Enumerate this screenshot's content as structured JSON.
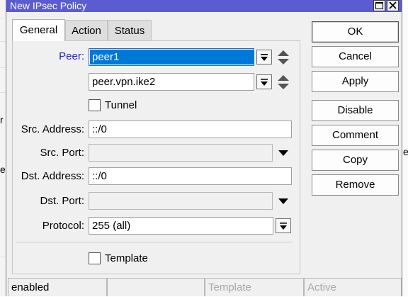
{
  "window": {
    "title": "New IPsec Policy"
  },
  "background_fragments": {
    "left_1": "r",
    "left_2": "er",
    "right_1": "e"
  },
  "tabs": [
    {
      "label": "General",
      "active": true
    },
    {
      "label": "Action",
      "active": false
    },
    {
      "label": "Status",
      "active": false
    }
  ],
  "form": {
    "peer": {
      "label": "Peer:",
      "value": "peer1",
      "value2": "peer.vpn.ike2"
    },
    "tunnel": {
      "label": "Tunnel",
      "checked": false
    },
    "src_address": {
      "label": "Src. Address:",
      "value": "::/0"
    },
    "src_port": {
      "label": "Src. Port:",
      "value": ""
    },
    "dst_address": {
      "label": "Dst. Address:",
      "value": "::/0"
    },
    "dst_port": {
      "label": "Dst. Port:",
      "value": ""
    },
    "protocol": {
      "label": "Protocol:",
      "value": "255 (all)"
    },
    "template": {
      "label": "Template",
      "checked": false
    }
  },
  "buttons": {
    "ok": "OK",
    "cancel": "Cancel",
    "apply": "Apply",
    "disable": "Disable",
    "comment": "Comment",
    "copy": "Copy",
    "remove": "Remove"
  },
  "statusbar": {
    "state": "enabled",
    "cell2": "",
    "template": "Template",
    "active": "Active"
  },
  "icons": {
    "dropdown": "dropdown-arrow-icon",
    "updown": "up-down-arrows-icon",
    "maximize": "maximize-icon",
    "close": "close-icon"
  },
  "colors": {
    "titlebar": "#5b5cd0",
    "peer_label": "#1f1fd0",
    "selection": "#0078d7"
  }
}
